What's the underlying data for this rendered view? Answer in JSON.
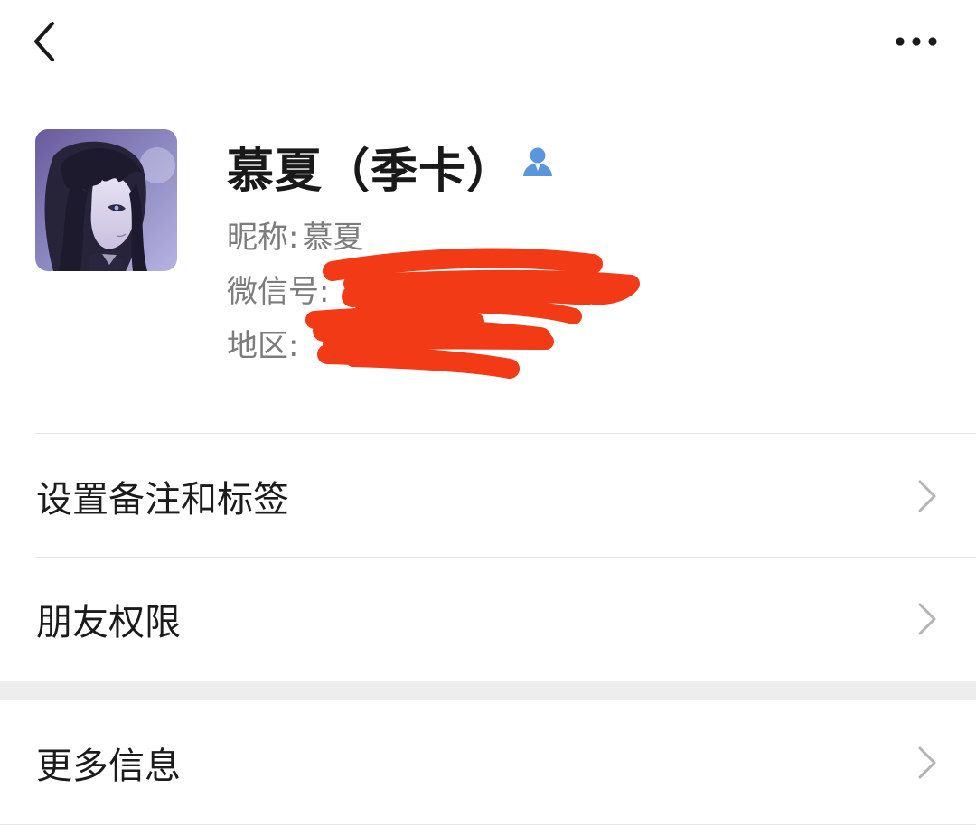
{
  "nav": {
    "back_icon": "chevron-left-icon",
    "more_icon": "more-horizontal-icon"
  },
  "profile": {
    "avatar": "anime-girl-avatar",
    "display_name": "慕夏（季卡）",
    "badge_icon": "contact-person-icon",
    "badge_color": "#5a96dc",
    "nickname_label": "昵称:",
    "nickname_value": "慕夏",
    "wechat_id_label": "微信号:",
    "region_label": "地区:",
    "redaction_color": "#f23a16"
  },
  "menu": {
    "items": [
      {
        "label": "设置备注和标签",
        "icon": "chevron-right-icon"
      },
      {
        "label": "朋友权限",
        "icon": "chevron-right-icon"
      },
      {
        "label": "更多信息",
        "icon": "chevron-right-icon"
      }
    ]
  }
}
